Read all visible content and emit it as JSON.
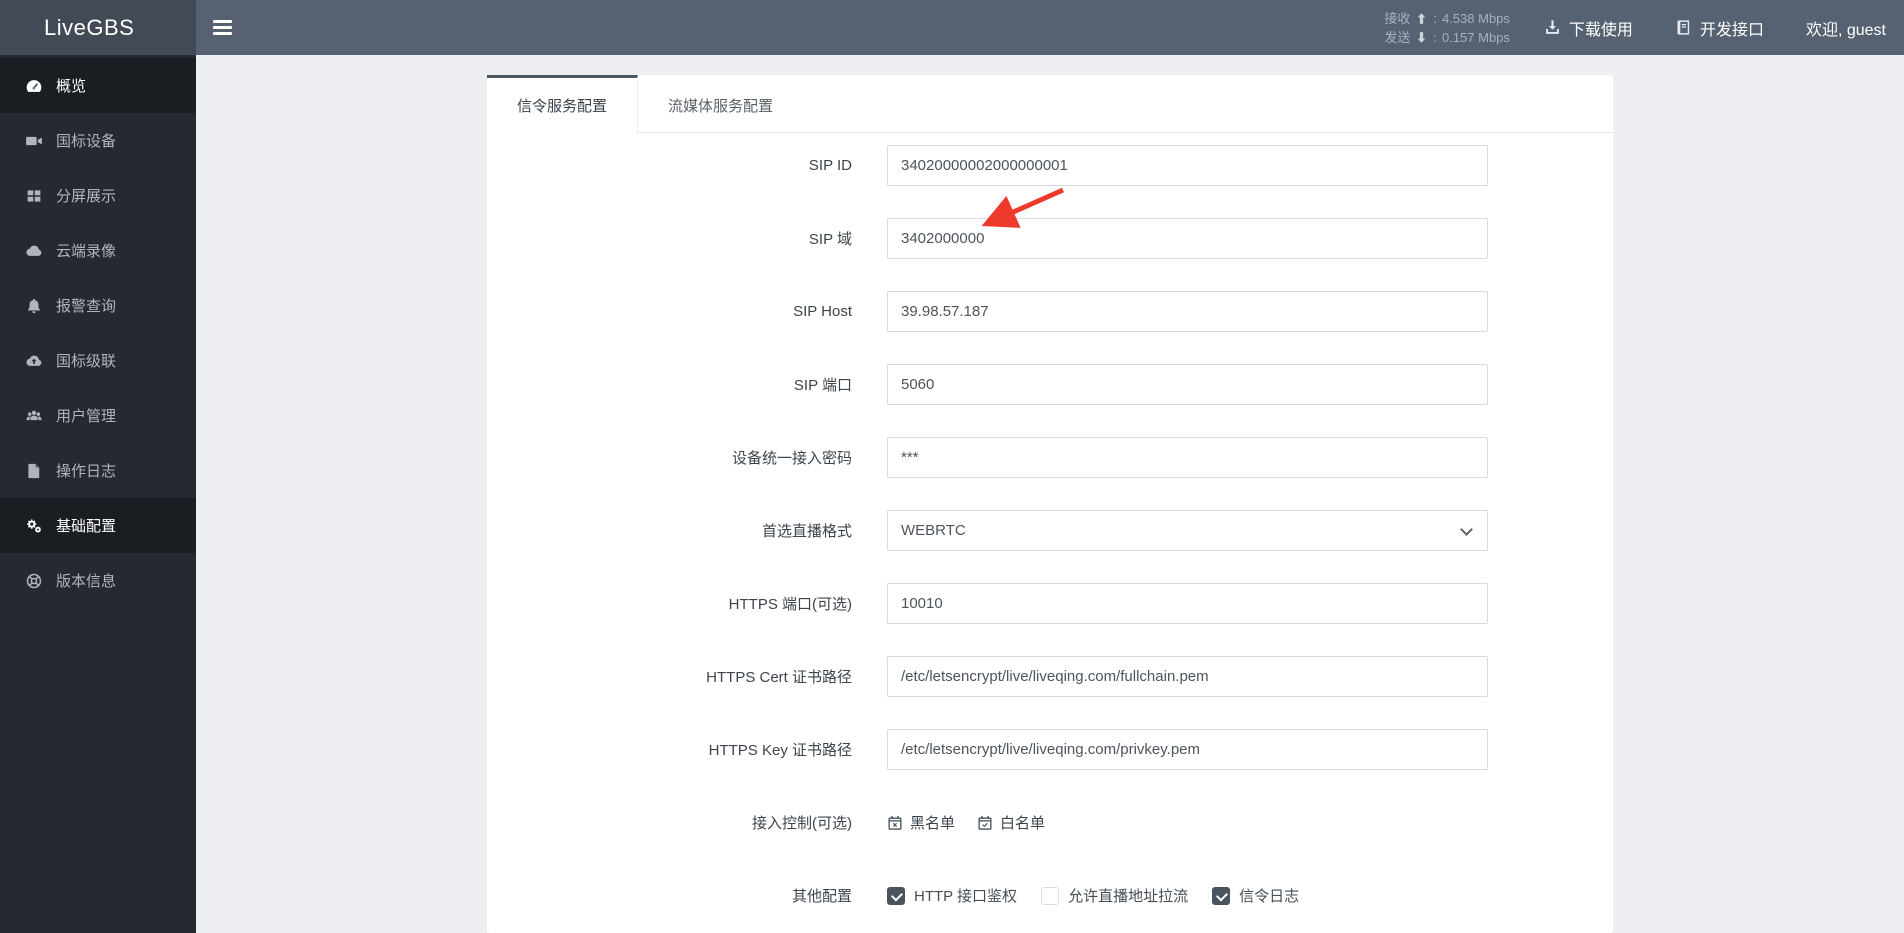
{
  "header": {
    "logo": "LiveGBS",
    "stats": {
      "rows": [
        {
          "label": "接收",
          "dir": "up",
          "value": "4.538 Mbps"
        },
        {
          "label": "发送",
          "dir": "down",
          "value": "0.157 Mbps"
        }
      ]
    },
    "links": [
      {
        "label": "下载使用",
        "icon": "download-icon",
        "name": "download-usage-link"
      },
      {
        "label": "开发接口",
        "icon": "book-icon",
        "name": "dev-api-link"
      }
    ],
    "welcome": "欢迎, guest"
  },
  "sidebar": {
    "items": [
      {
        "label": "概览",
        "icon": "dashboard-icon",
        "active": true
      },
      {
        "label": "国标设备",
        "icon": "video-camera-icon",
        "active": false
      },
      {
        "label": "分屏展示",
        "icon": "grid-icon",
        "active": false
      },
      {
        "label": "云端录像",
        "icon": "cloud-icon",
        "active": false
      },
      {
        "label": "报警查询",
        "icon": "bell-icon",
        "active": false
      },
      {
        "label": "国标级联",
        "icon": "cloud-upload-icon",
        "active": false
      },
      {
        "label": "用户管理",
        "icon": "users-icon",
        "active": false
      },
      {
        "label": "操作日志",
        "icon": "file-icon",
        "active": false
      },
      {
        "label": "基础配置",
        "icon": "gears-icon",
        "active": true
      },
      {
        "label": "版本信息",
        "icon": "version-icon",
        "active": false
      }
    ]
  },
  "tabs": [
    {
      "label": "信令服务配置",
      "active": true
    },
    {
      "label": "流媒体服务配置",
      "active": false
    }
  ],
  "form": {
    "fields": [
      {
        "label": "SIP ID",
        "type": "text",
        "value": "34020000002000000001"
      },
      {
        "label": "SIP 域",
        "type": "text",
        "value": "3402000000"
      },
      {
        "label": "SIP Host",
        "type": "text",
        "value": "39.98.57.187"
      },
      {
        "label": "SIP 端口",
        "type": "text",
        "value": "5060"
      },
      {
        "label": "设备统一接入密码",
        "type": "text",
        "value": "***"
      },
      {
        "label": "首选直播格式",
        "type": "select",
        "value": "WEBRTC"
      },
      {
        "label": "HTTPS 端口(可选)",
        "type": "text",
        "value": "10010"
      },
      {
        "label": "HTTPS Cert 证书路径",
        "type": "text",
        "value": "/etc/letsencrypt/live/liveqing.com/fullchain.pem"
      },
      {
        "label": "HTTPS Key 证书路径",
        "type": "text",
        "value": "/etc/letsencrypt/live/liveqing.com/privkey.pem"
      }
    ],
    "access_control": {
      "label": "接入控制(可选)",
      "buttons": [
        {
          "label": "黑名单",
          "icon": "calendar-x-icon"
        },
        {
          "label": "白名单",
          "icon": "calendar-check-icon"
        }
      ]
    },
    "other": {
      "label": "其他配置",
      "checkboxes": [
        {
          "label": "HTTP 接口鉴权",
          "checked": true
        },
        {
          "label": "允许直播地址拉流",
          "checked": false
        },
        {
          "label": "信令日志",
          "checked": true
        }
      ]
    }
  },
  "annotation": {
    "type": "arrow",
    "target": "SIP 域",
    "color": "#ee3a2c"
  }
}
